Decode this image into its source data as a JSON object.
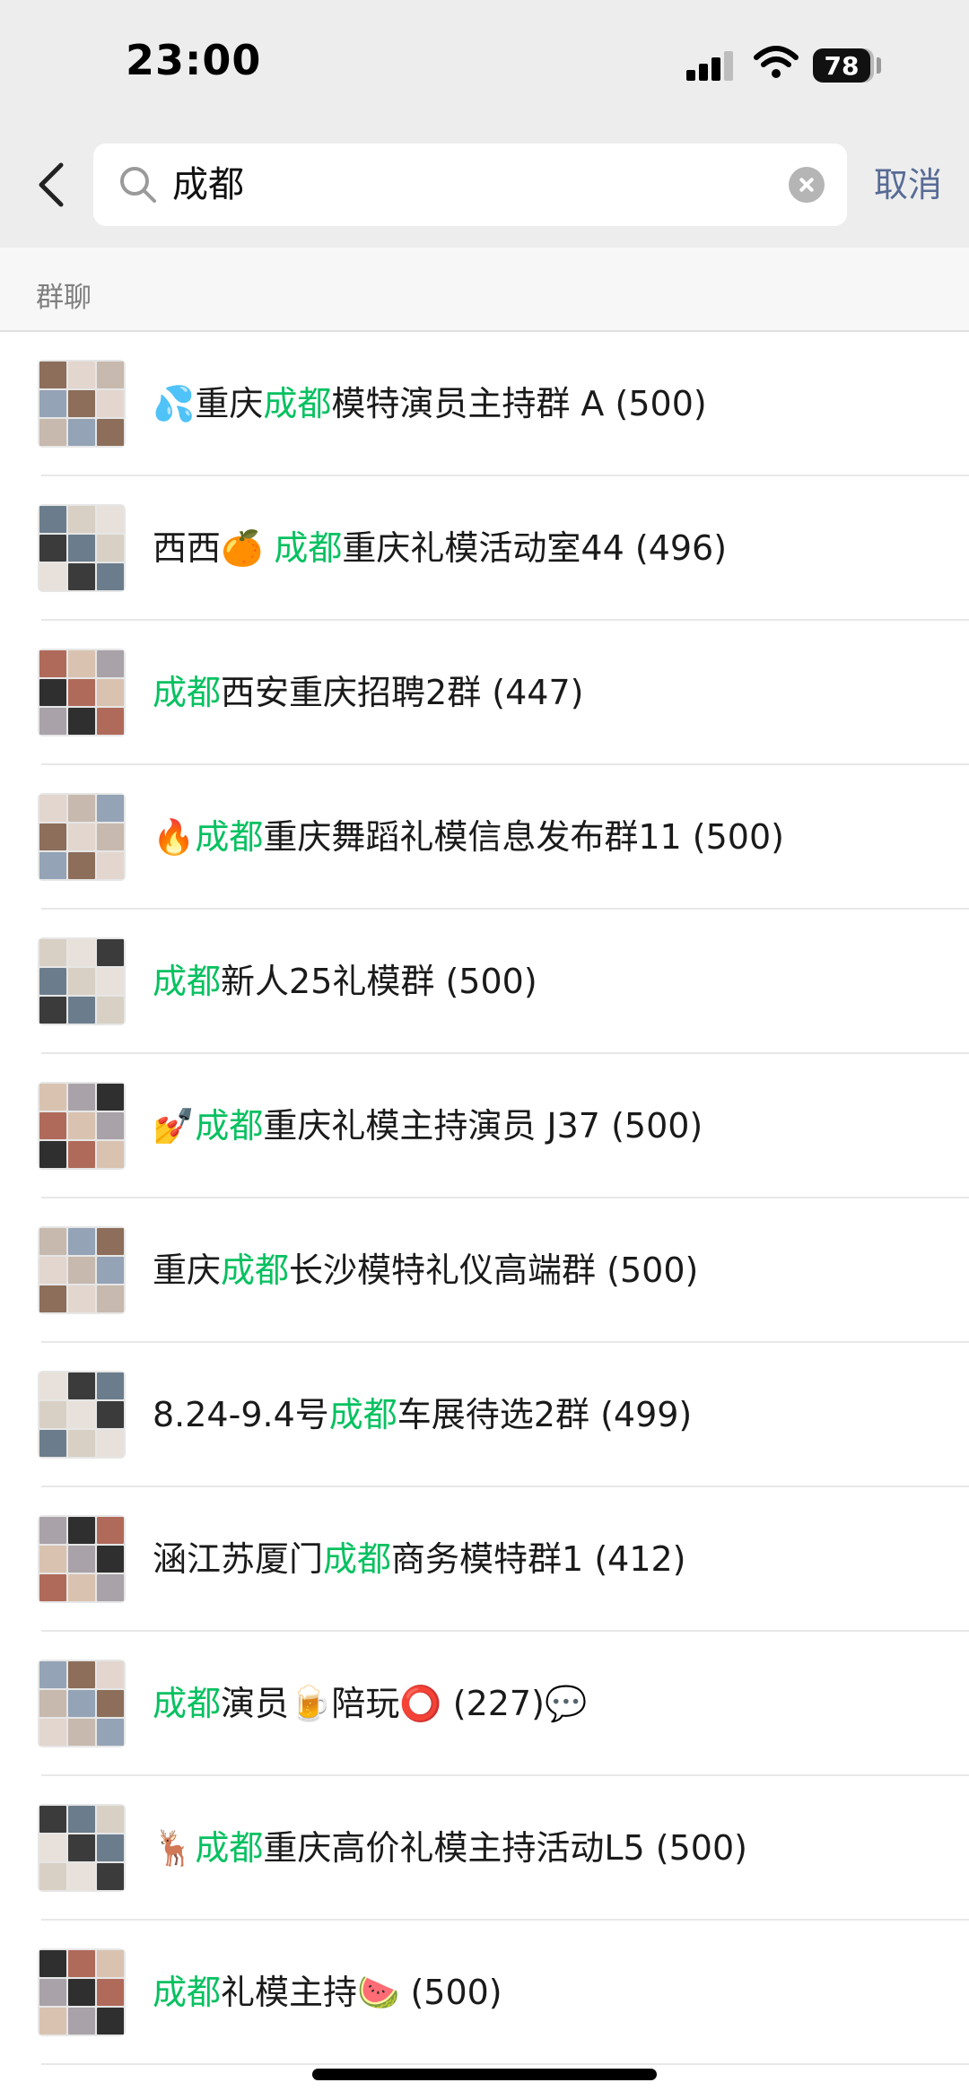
{
  "status_bar": {
    "time": "23:00",
    "battery": "78"
  },
  "search": {
    "query": "成都",
    "cancel_label": "取消"
  },
  "section": {
    "title": "群聊"
  },
  "groups": [
    {
      "prefix": "💦重庆",
      "highlight": "成都",
      "suffix": "模特演员主持群 A",
      "count": "(500)",
      "trail": ""
    },
    {
      "prefix": "西西🍊 ",
      "highlight": "成都",
      "suffix": "重庆礼模活动室44",
      "count": "(496)",
      "trail": ""
    },
    {
      "prefix": "",
      "highlight": "成都",
      "suffix": "西安重庆招聘2群",
      "count": "(447)",
      "trail": ""
    },
    {
      "prefix": "🔥",
      "highlight": "成都",
      "suffix": "重庆舞蹈礼模信息发布群11",
      "count": "(500)",
      "trail": ""
    },
    {
      "prefix": "",
      "highlight": "成都",
      "suffix": "新人25礼模群",
      "count": "(500)",
      "trail": ""
    },
    {
      "prefix": "💅",
      "highlight": "成都",
      "suffix": "重庆礼模主持演员 J37",
      "count": "(500)",
      "trail": ""
    },
    {
      "prefix": "重庆",
      "highlight": "成都",
      "suffix": "长沙模特礼仪高端群",
      "count": "(500)",
      "trail": ""
    },
    {
      "prefix": "8.24-9.4号",
      "highlight": "成都",
      "suffix": "车展待选2群",
      "count": "(499)",
      "trail": ""
    },
    {
      "prefix": "涵江苏厦门",
      "highlight": "成都",
      "suffix": "商务模特群1",
      "count": "(412)",
      "trail": ""
    },
    {
      "prefix": "",
      "highlight": "成都",
      "suffix": "演员🍺陪玩⭕",
      "count": "(227)",
      "trail": "💬"
    },
    {
      "prefix": "🦌",
      "highlight": "成都",
      "suffix": "重庆高价礼模主持活动L5",
      "count": "(500)",
      "trail": ""
    },
    {
      "prefix": "",
      "highlight": "成都",
      "suffix": "礼模主持🍉",
      "count": "(500)",
      "trail": ""
    }
  ],
  "colors": {
    "highlight": "#07c160",
    "link": "#576b95",
    "header_bg": "#ededed"
  },
  "icons": {
    "back": "chevron-left-icon",
    "search": "search-icon",
    "clear": "clear-circle-icon"
  }
}
